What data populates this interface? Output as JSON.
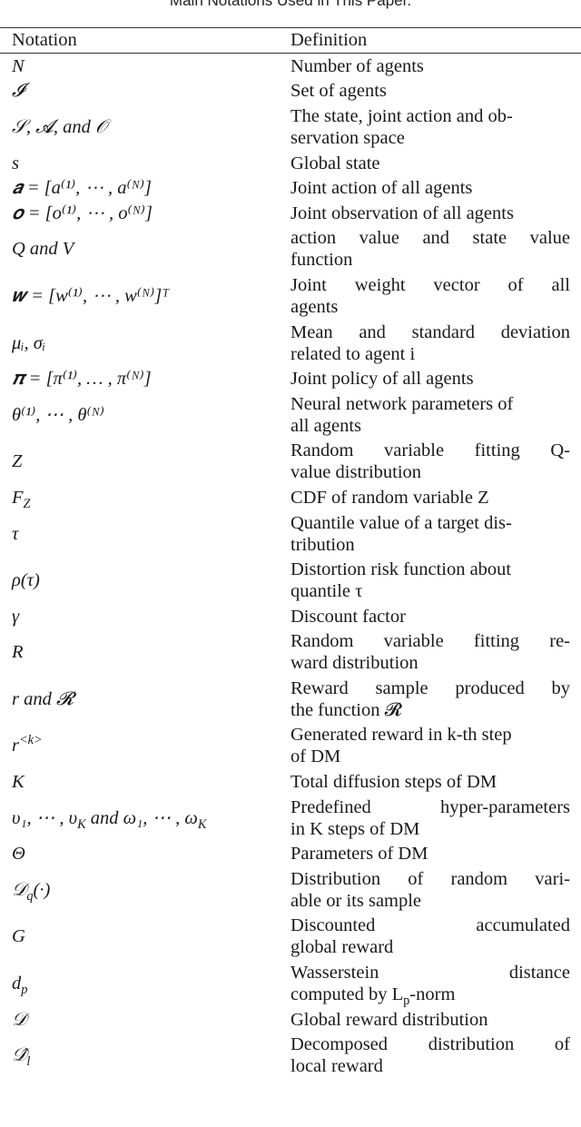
{
  "caption": "Main Notations Used in This Paper.",
  "table": {
    "headers": {
      "notation": "Notation",
      "definition": "Definition"
    },
    "rows": [
      {
        "notation": "N",
        "definition": [
          "Number of agents"
        ]
      },
      {
        "notation": "𝓘",
        "definition": [
          "Set of agents"
        ]
      },
      {
        "notation": "𝒮, 𝓐, and 𝒪",
        "definition": [
          "The state, joint action and ob-",
          "servation space"
        ]
      },
      {
        "notation": "s",
        "definition": [
          "Global state"
        ]
      },
      {
        "notation": "𝒂 = [a⁽¹⁾, ⋯ , a⁽ᴺ⁾]",
        "definition": [
          "Joint action of all agents"
        ]
      },
      {
        "notation": "𝒐 = [o⁽¹⁾, ⋯ , o⁽ᴺ⁾]",
        "definition": [
          "Joint observation of all agents"
        ]
      },
      {
        "notation": "Q and V",
        "definition": [
          "action value and state value",
          "function"
        ]
      },
      {
        "notation": "𝒘 = [w⁽¹⁾, ⋯ , w⁽ᴺ⁾]ᵀ",
        "definition": [
          "Joint weight vector of all",
          "agents"
        ]
      },
      {
        "notation": "μᵢ, σᵢ",
        "definition": [
          "Mean and standard deviation",
          "related to agent i"
        ]
      },
      {
        "notation": "𝝅 = [π⁽¹⁾, … , π⁽ᴺ⁾]",
        "definition": [
          "Joint policy of all agents"
        ]
      },
      {
        "notation": "θ⁽¹⁾, ⋯ , θ⁽ᴺ⁾",
        "definition": [
          "Neural network parameters of",
          "all agents"
        ]
      },
      {
        "notation": "Z",
        "definition": [
          "Random variable fitting Q-",
          "value distribution"
        ]
      },
      {
        "notation": "F_Z",
        "definition": [
          "CDF of random variable Z"
        ]
      },
      {
        "notation": "τ",
        "definition": [
          "Quantile value of a target dis-",
          "tribution"
        ]
      },
      {
        "notation": "ρ(τ)",
        "definition": [
          "Distortion risk function about",
          "quantile τ"
        ]
      },
      {
        "notation": "γ",
        "definition": [
          "Discount factor"
        ]
      },
      {
        "notation": "R",
        "definition": [
          "Random variable fitting re-",
          "ward distribution"
        ]
      },
      {
        "notation": "r and 𝓡",
        "definition": [
          "Reward sample produced by",
          "the function 𝓡"
        ]
      },
      {
        "notation": "r^<k>",
        "definition": [
          "Generated reward in k-th step",
          "of DM"
        ]
      },
      {
        "notation": "K",
        "definition": [
          "Total diffusion steps of DM"
        ]
      },
      {
        "notation": "υ₁, ⋯ , υ_K and ω₁, ⋯ , ω_K",
        "definition": [
          "Predefined hyper-parameters",
          "in K steps of DM"
        ]
      },
      {
        "notation": "Θ",
        "definition": [
          "Parameters of DM"
        ]
      },
      {
        "notation": "𝒟_q(·)",
        "definition": [
          "Distribution of random vari-",
          "able or its sample"
        ]
      },
      {
        "notation": "G",
        "definition": [
          "Discounted accumulated",
          "global reward"
        ]
      },
      {
        "notation": "d_p",
        "definition": [
          "Wasserstein distance",
          "computed by L_p-norm"
        ]
      },
      {
        "notation": "𝒟",
        "definition": [
          "Global reward distribution"
        ]
      },
      {
        "notation": "𝒟̂_l",
        "definition": [
          "Decomposed distribution of",
          "local reward"
        ]
      }
    ]
  }
}
